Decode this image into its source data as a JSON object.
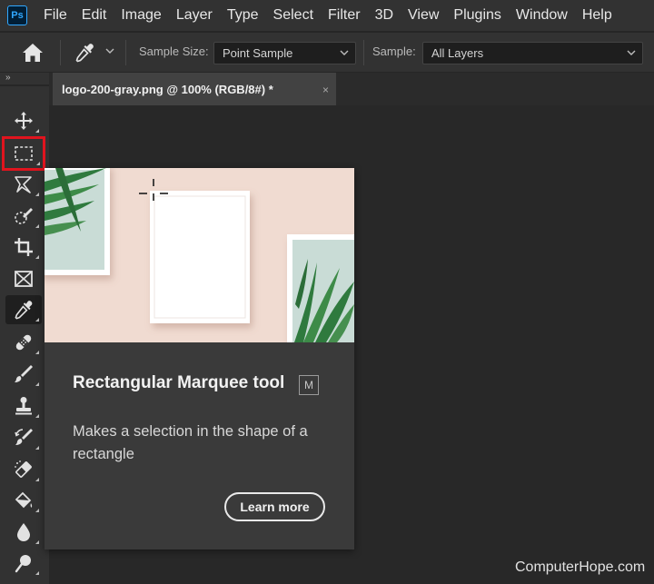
{
  "menubar": {
    "logo": "Ps",
    "items": [
      "File",
      "Edit",
      "Image",
      "Layer",
      "Type",
      "Select",
      "Filter",
      "3D",
      "View",
      "Plugins",
      "Window",
      "Help"
    ]
  },
  "options_bar": {
    "sample_size_label": "Sample Size:",
    "sample_size_value": "Point Sample",
    "sample_label": "Sample:",
    "sample_value": "All Layers"
  },
  "toolbar": {
    "collapse_glyph": "»",
    "tools": [
      {
        "name": "move-tool",
        "icon": "move-icon"
      },
      {
        "name": "rectangular-marquee-tool",
        "icon": "marquee-icon",
        "highlighted": true
      },
      {
        "name": "lasso-tool",
        "icon": "lasso-icon"
      },
      {
        "name": "quick-selection-tool",
        "icon": "quick-selection-icon"
      },
      {
        "name": "crop-tool",
        "icon": "crop-icon"
      },
      {
        "name": "frame-tool",
        "icon": "frame-icon"
      },
      {
        "name": "eyedropper-tool",
        "icon": "eyedropper-icon",
        "active": true
      },
      {
        "name": "healing-brush-tool",
        "icon": "bandage-icon"
      },
      {
        "name": "brush-tool",
        "icon": "brush-icon"
      },
      {
        "name": "clone-stamp-tool",
        "icon": "stamp-icon"
      },
      {
        "name": "history-brush-tool",
        "icon": "history-brush-icon"
      },
      {
        "name": "eraser-tool",
        "icon": "eraser-icon"
      },
      {
        "name": "paint-bucket-tool",
        "icon": "bucket-icon"
      },
      {
        "name": "blur-tool",
        "icon": "drop-icon"
      },
      {
        "name": "dodge-tool",
        "icon": "dodge-icon"
      }
    ]
  },
  "document": {
    "tab_title": "logo-200-gray.png @ 100% (RGB/8#) *",
    "close_glyph": "×"
  },
  "tooltip": {
    "title": "Rectangular Marquee tool",
    "shortcut": "M",
    "description": "Makes a selection in the shape of a rectangle",
    "learn_more": "Learn more"
  },
  "watermark": "ComputerHope.com",
  "colors": {
    "highlight_box": "#e0141e",
    "ps_blue": "#31a8ff",
    "ui_panel": "#323232",
    "tooltip_bg": "#3a3a3a"
  }
}
